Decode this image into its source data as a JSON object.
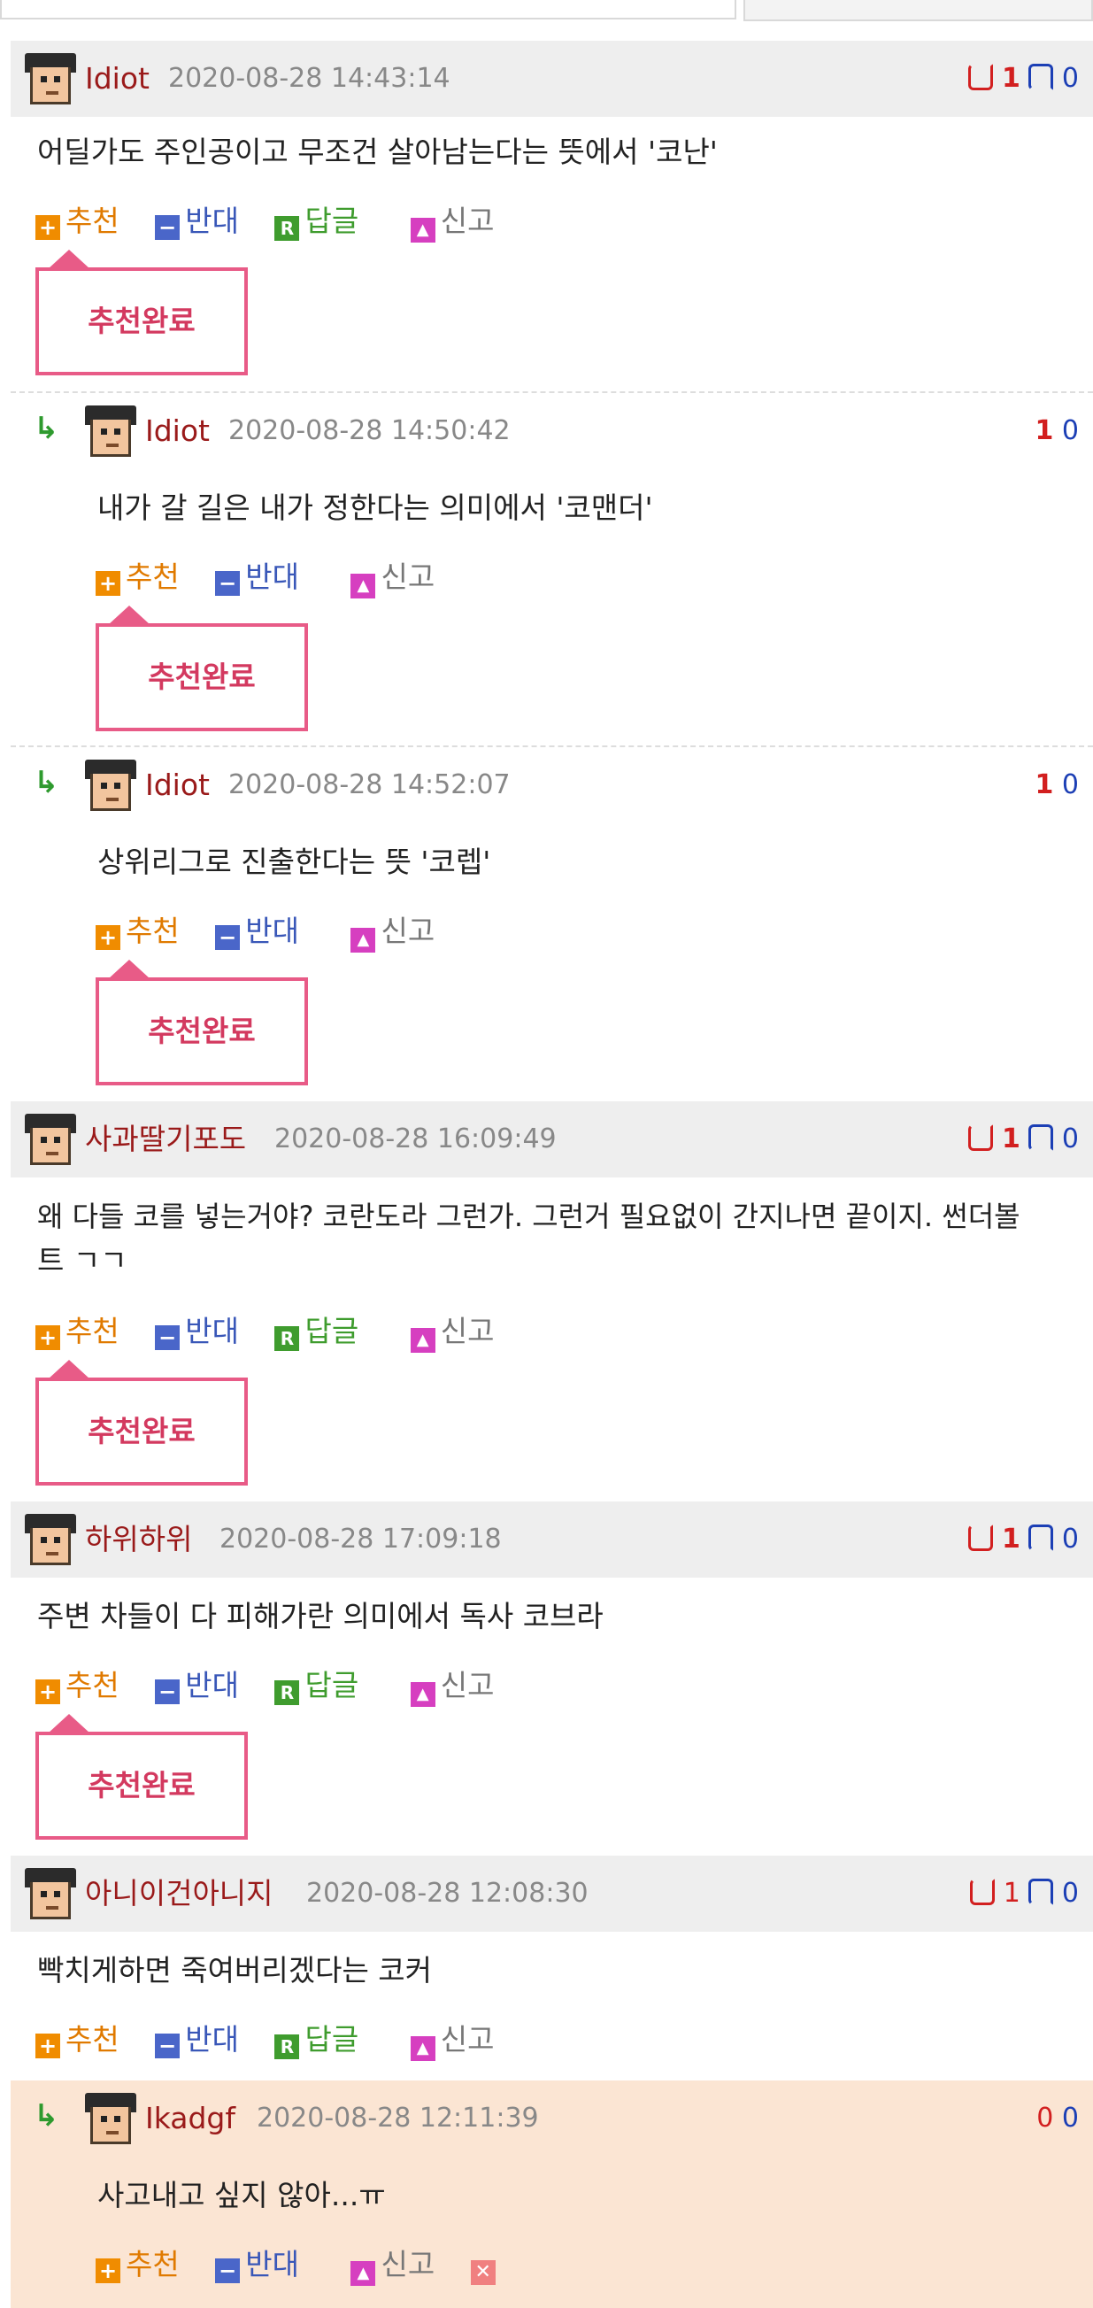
{
  "actions": {
    "recommend": "추천",
    "oppose": "반대",
    "reply": "답글",
    "report": "신고",
    "recommended_done": "추천완료"
  },
  "comments": [
    {
      "nick": "Idiot",
      "date": "2020-08-28 14:43:14",
      "up": "1",
      "down": "0",
      "text": "어딜가도 주인공이고 무조건 살아남는다는 뜻에서 '코난'"
    },
    {
      "nick": "Idiot",
      "date": "2020-08-28 14:50:42",
      "up": "1",
      "down": "0",
      "text": "내가 갈 길은 내가 정한다는 의미에서 '코맨더'"
    },
    {
      "nick": "Idiot",
      "date": "2020-08-28 14:52:07",
      "up": "1",
      "down": "0",
      "text": "상위리그로 진출한다는 뜻 '코렙'"
    },
    {
      "nick": "사과딸기포도",
      "date": "2020-08-28 16:09:49",
      "up": "1",
      "down": "0",
      "text_line1": "왜 다들 코를 넣는거야? 코란도라 그런가. 그런거 필요없이 간지나면 끝이지. 썬더볼",
      "text_line2": "트 ㄱㄱ"
    },
    {
      "nick": "하위하위",
      "date": "2020-08-28 17:09:18",
      "up": "1",
      "down": "0",
      "text": "주변 차들이 다 피해가란 의미에서 독사 코브라"
    },
    {
      "nick": "아니이건아니지",
      "date": "2020-08-28 12:08:30",
      "up": "1",
      "down": "0",
      "text": "빡치게하면 죽여버리겠다는 코커"
    },
    {
      "nick": "Ikadgf",
      "date": "2020-08-28 12:11:39",
      "up": "0",
      "down": "0",
      "text": "사고내고 싶지 않아...ㅠ"
    }
  ],
  "colors": {
    "nick": "#9a1a1a",
    "date": "#888888",
    "up": "#d21f1f",
    "down": "#1c3fb5",
    "header_bg": "#eeeeee",
    "highlight_bg": "#fbe5d3",
    "bubble_border": "#e85b87"
  },
  "icons": [
    "thumbs-up-icon",
    "thumbs-down-icon",
    "reply-arrow-icon",
    "plus-icon",
    "minus-icon",
    "reply-r-icon",
    "report-siren-icon",
    "delete-x-icon"
  ]
}
